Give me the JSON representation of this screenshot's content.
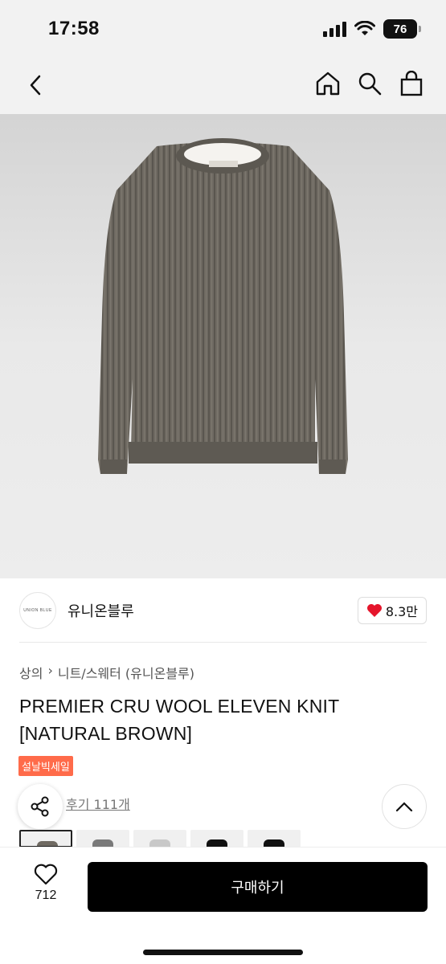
{
  "status": {
    "time": "17:58",
    "battery": "76"
  },
  "nav": {
    "back_icon": "chevron-left-icon",
    "icons": [
      "home-icon",
      "search-icon",
      "shopping-bag-icon"
    ]
  },
  "product_image": {
    "logo_text": "UNION BLUE",
    "color": "#6f6a62"
  },
  "brand": {
    "logo_text": "UNION BLUE",
    "name": "유니온블루",
    "likes": "8.3만",
    "heart_color": "#e5152b"
  },
  "breadcrumb": {
    "category": "상의",
    "sub": "니트/스웨터 (유니온블루)"
  },
  "product": {
    "title": "PREMIER CRU WOOL ELEVEN KNIT [NATURAL BROWN]",
    "sale_badge": "설날빅세일",
    "review": "후기 111개"
  },
  "bottom": {
    "wish_count": "712",
    "buy_label": "구매하기"
  },
  "colors": {
    "sale": "#ff6b4a",
    "buy_button": "#000000"
  }
}
